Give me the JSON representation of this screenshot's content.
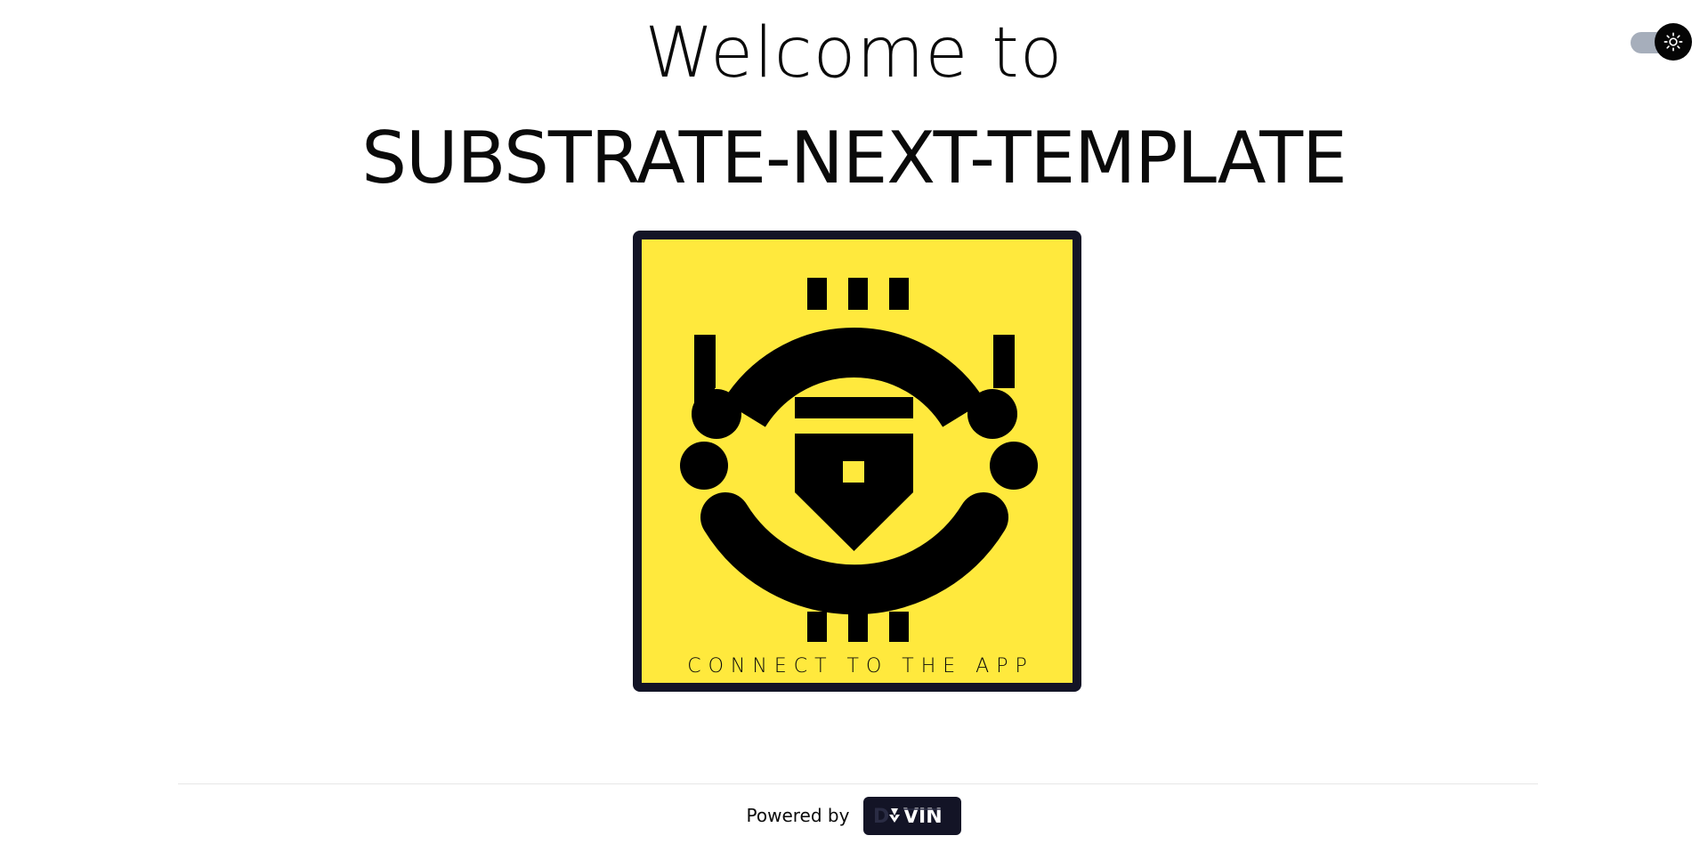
{
  "header": {
    "welcome": "Welcome to",
    "title": "SUBSTRATE-NEXT-TEMPLATE"
  },
  "theme_toggle": {
    "icon": "sun-icon",
    "mode": "light"
  },
  "connect_card": {
    "label": "CONNECT TO THE APP",
    "logo": "substrate-app-logo",
    "background_color": "#ffe93d",
    "border_color": "#131426"
  },
  "footer": {
    "powered_by": "Powered by",
    "brand": "DEVIN",
    "brand_badge_color": "#131426"
  }
}
